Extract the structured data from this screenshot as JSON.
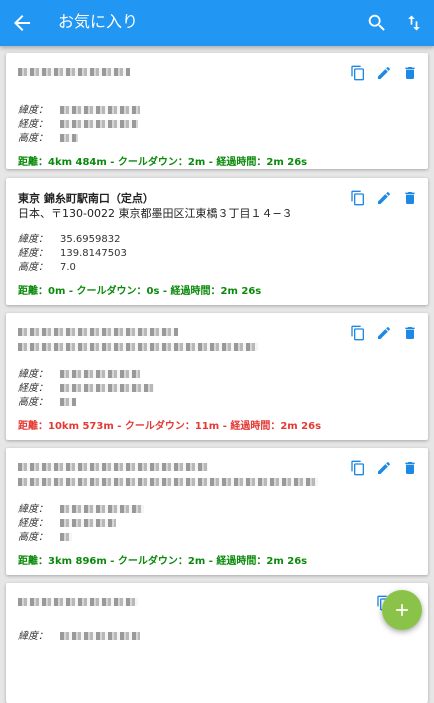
{
  "appbar": {
    "title": "お気に入り",
    "icons": [
      "back-arrow-icon",
      "search-icon",
      "sort-icon"
    ]
  },
  "colors": {
    "primary": "#2196f3",
    "ok": "#0a8a0a",
    "alert": "#e53935",
    "fab": "#8bc34a"
  },
  "labels": {
    "lat": "緯度：",
    "lng": "経度：",
    "alt": "高度："
  },
  "cards": [
    {
      "name": "",
      "address": "",
      "lat": "",
      "lng": "",
      "alt": "",
      "status": "距離：4km 484m - クールダウン：2m - 経過時間：2m 26s",
      "status_color": "ok"
    },
    {
      "name": "東京 錦糸町駅南口（定点）",
      "address": "日本、〒130-0022 東京都墨田区江東橋３丁目１４−３",
      "lat": "35.6959832",
      "lng": "139.8147503",
      "alt": "7.0",
      "status": "距離：0m - クールダウン：0s - 経過時間：2m 26s",
      "status_color": "ok"
    },
    {
      "name": "",
      "address": "",
      "lat": "",
      "lng": "",
      "alt": "",
      "status": "距離：10km 573m - クールダウン：11m - 経過時間：2m 26s",
      "status_color": "alert"
    },
    {
      "name": "",
      "address": "",
      "lat": "",
      "lng": "",
      "alt": "",
      "status": "距離：3km 896m - クールダウン：2m - 経過時間：2m 26s",
      "status_color": "ok"
    },
    {
      "name": "",
      "address": "",
      "lat": "",
      "lng": "",
      "alt": "",
      "status": "",
      "status_color": "ok"
    }
  ]
}
